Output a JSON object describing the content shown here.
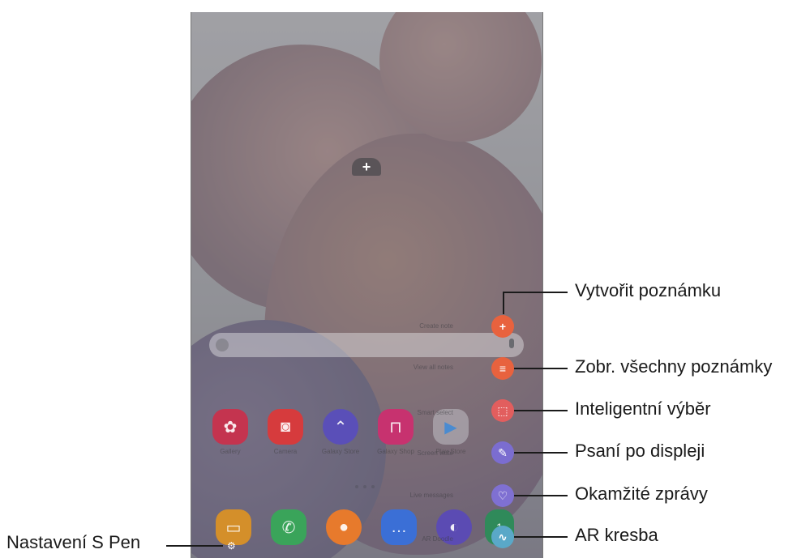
{
  "callouts": {
    "create_note": "Vytvořit poznámku",
    "view_all_notes": "Zobr. všechny poznámky",
    "smart_select": "Inteligentní výběr",
    "screen_write": "Psaní po displeji",
    "live_messages": "Okamžité zprávy",
    "ar_doodle": "AR kresba",
    "spen_settings": "Nastavení S Pen"
  },
  "air_command_labels": {
    "create_note": "Create note",
    "view_all_notes": "View all notes",
    "smart_select": "Smart select",
    "screen_write": "Screen write",
    "live_messages": "Live messages",
    "ar_doodle": "AR Doodle"
  },
  "apps": [
    {
      "name": "Gallery",
      "icon": "flower-icon",
      "color": "#c4344f"
    },
    {
      "name": "Camera",
      "icon": "camera-icon",
      "color": "#d63b3d"
    },
    {
      "name": "Galaxy Store",
      "icon": "chevron-up-icon",
      "color": "#5a4fb8"
    },
    {
      "name": "Galaxy Shop",
      "icon": "bag-icon",
      "color": "#c7326f"
    },
    {
      "name": "Play Store",
      "icon": "play-icon",
      "color": "#9fa3a8"
    }
  ],
  "dock": [
    {
      "icon": "folder-icon",
      "color": "#d48f2a"
    },
    {
      "icon": "phone-icon",
      "color": "#3aa45a"
    },
    {
      "icon": "contact-icon",
      "color": "#e77a2c"
    },
    {
      "icon": "messages-icon",
      "color": "#3b6fd6"
    },
    {
      "icon": "internet-icon",
      "color": "#5b4bb3"
    },
    {
      "icon": "calendar-icon",
      "color": "#2f8a5a",
      "text": "1"
    }
  ],
  "colors": {
    "create_note": "#e8623e",
    "view_all_notes": "#e8623e",
    "smart_select": "#e25e5e",
    "screen_write": "#7b6dd0",
    "live_messages": "#7f70d2",
    "ar_doodle": "#5aa8c8"
  }
}
